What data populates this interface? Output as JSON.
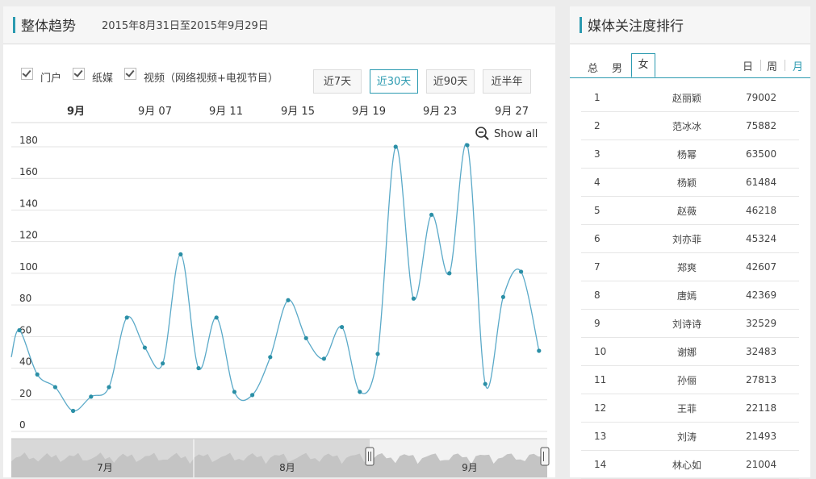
{
  "left": {
    "title": "整体趋势",
    "date_range": "2015年8月31日至2015年9月29日",
    "filters": [
      {
        "label": "门户",
        "checked": true
      },
      {
        "label": "纸媒",
        "checked": true
      },
      {
        "label": "视频（网络视频+电视节目）",
        "checked": true
      }
    ],
    "ranges": [
      {
        "label": "近7天",
        "active": false
      },
      {
        "label": "近30天",
        "active": true
      },
      {
        "label": "近90天",
        "active": false
      },
      {
        "label": "近半年",
        "active": false
      }
    ],
    "show_all": "Show all"
  },
  "chart_data": {
    "type": "line",
    "x_top_labels": [
      "9月",
      "9月 07",
      "9月 11",
      "9月 15",
      "9月 19",
      "9月 23",
      "9月 27"
    ],
    "y_ticks": [
      0,
      20,
      40,
      60,
      80,
      100,
      120,
      140,
      160,
      180
    ],
    "ylim": [
      0,
      180
    ],
    "points": [
      {
        "day": 1,
        "value": 64
      },
      {
        "day": 2,
        "value": 36
      },
      {
        "day": 3,
        "value": 28
      },
      {
        "day": 4,
        "value": 13
      },
      {
        "day": 5,
        "value": 22
      },
      {
        "day": 6,
        "value": 28
      },
      {
        "day": 7,
        "value": 72
      },
      {
        "day": 8,
        "value": 53
      },
      {
        "day": 9,
        "value": 43
      },
      {
        "day": 10,
        "value": 112
      },
      {
        "day": 11,
        "value": 40
      },
      {
        "day": 12,
        "value": 72
      },
      {
        "day": 13,
        "value": 25
      },
      {
        "day": 14,
        "value": 23
      },
      {
        "day": 15,
        "value": 47
      },
      {
        "day": 16,
        "value": 83
      },
      {
        "day": 17,
        "value": 59
      },
      {
        "day": 18,
        "value": 46
      },
      {
        "day": 19,
        "value": 66
      },
      {
        "day": 20,
        "value": 25
      },
      {
        "day": 21,
        "value": 49
      },
      {
        "day": 22,
        "value": 180
      },
      {
        "day": 23,
        "value": 84
      },
      {
        "day": 24,
        "value": 137
      },
      {
        "day": 25,
        "value": 100
      },
      {
        "day": 26,
        "value": 181
      },
      {
        "day": 27,
        "value": 30
      },
      {
        "day": 28,
        "value": 85
      },
      {
        "day": 29,
        "value": 101
      },
      {
        "day": 30,
        "value": 51
      }
    ],
    "navigator_labels": [
      "7月",
      "8月",
      "9月"
    ],
    "line_color": "#5aa9c8",
    "marker_color": "#2b8fa6",
    "grid": true
  },
  "right": {
    "title": "媒体关注度排行",
    "gender_tabs": [
      {
        "label": "总",
        "active": false
      },
      {
        "label": "男",
        "active": false
      },
      {
        "label": "女",
        "active": true
      }
    ],
    "period_tabs": [
      {
        "label": "日",
        "active": false
      },
      {
        "label": "周",
        "active": false
      },
      {
        "label": "月",
        "active": true
      }
    ],
    "rankings": [
      {
        "rank": "1",
        "name": "赵丽颖",
        "score": "79002"
      },
      {
        "rank": "2",
        "name": "范冰冰",
        "score": "75882"
      },
      {
        "rank": "3",
        "name": "杨幂",
        "score": "63500"
      },
      {
        "rank": "4",
        "name": "杨颖",
        "score": "61484"
      },
      {
        "rank": "5",
        "name": "赵薇",
        "score": "46218"
      },
      {
        "rank": "6",
        "name": "刘亦菲",
        "score": "45324"
      },
      {
        "rank": "7",
        "name": "郑爽",
        "score": "42607"
      },
      {
        "rank": "8",
        "name": "唐嫣",
        "score": "42369"
      },
      {
        "rank": "9",
        "name": "刘诗诗",
        "score": "32529"
      },
      {
        "rank": "10",
        "name": "谢娜",
        "score": "32483"
      },
      {
        "rank": "11",
        "name": "孙俪",
        "score": "27813"
      },
      {
        "rank": "12",
        "name": "王菲",
        "score": "22118"
      },
      {
        "rank": "13",
        "name": "刘涛",
        "score": "21493"
      },
      {
        "rank": "14",
        "name": "林心如",
        "score": "21004"
      }
    ]
  },
  "colors": {
    "accent": "#2b9ab0"
  }
}
